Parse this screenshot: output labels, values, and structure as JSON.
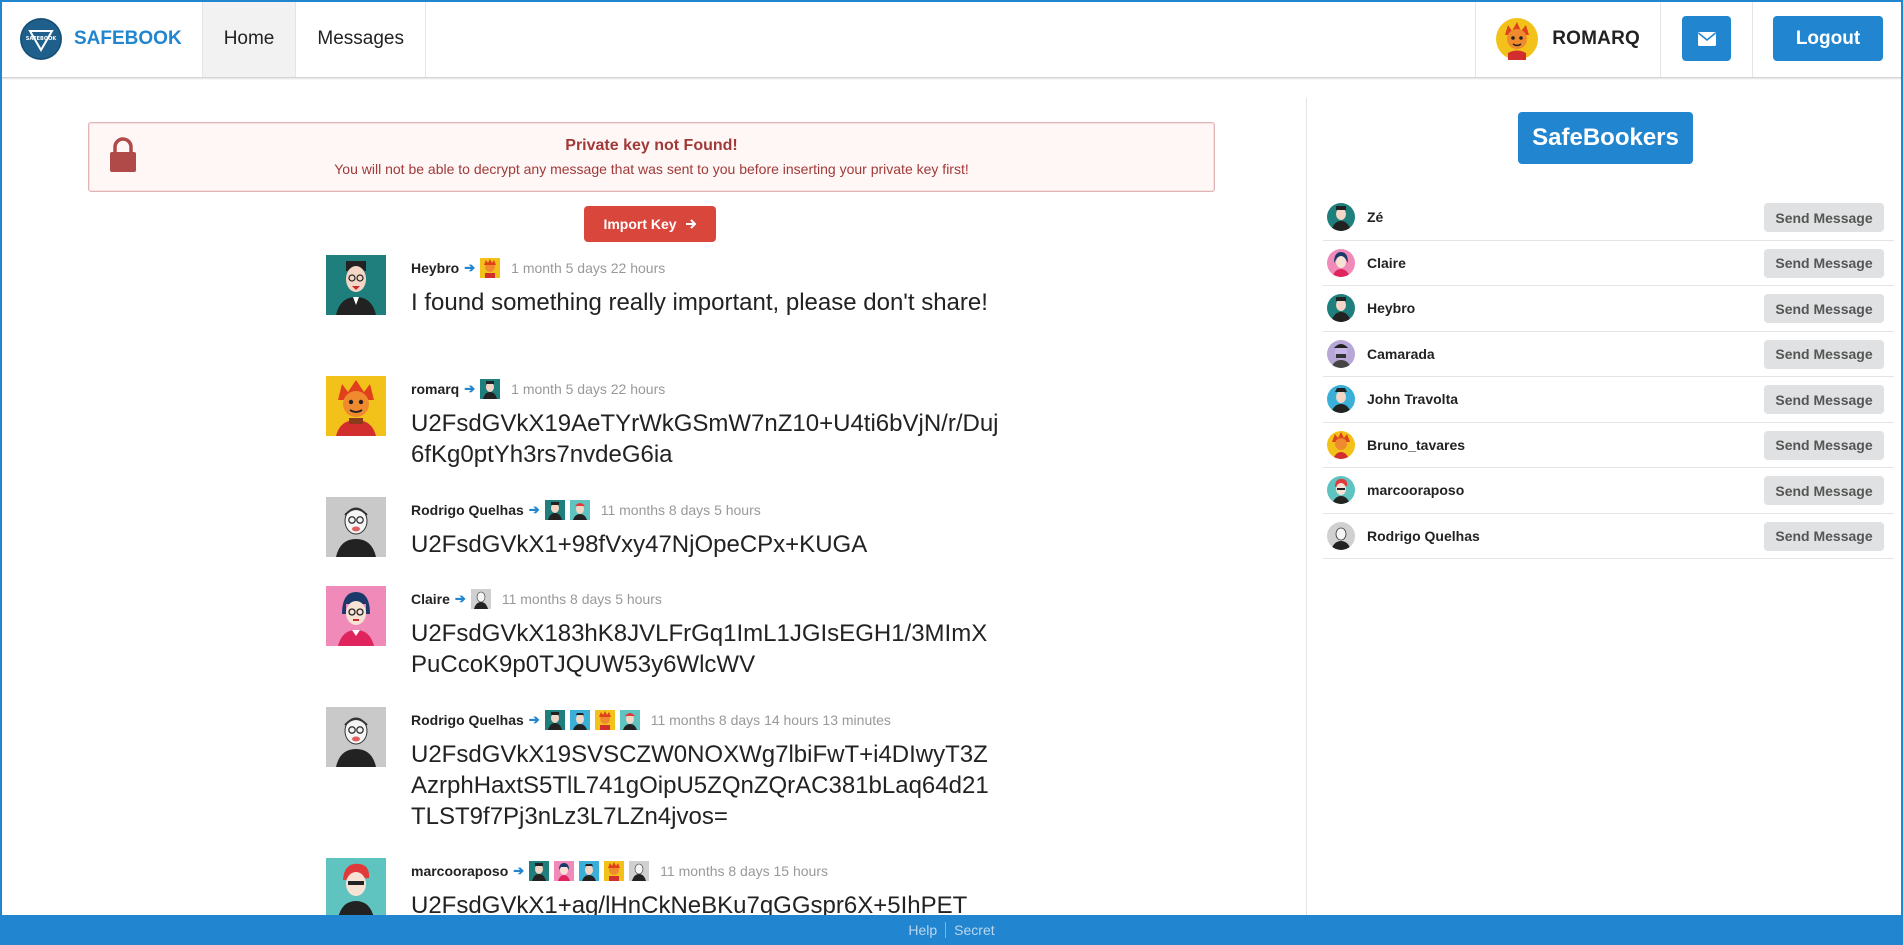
{
  "brand": {
    "name": "SAFEBOOK",
    "logo_text": "SAFEBOOK"
  },
  "nav": {
    "home": "Home",
    "messages": "Messages"
  },
  "user": {
    "name": "ROMARQ"
  },
  "header": {
    "mail_icon": "envelope-icon",
    "logout": "Logout"
  },
  "alert": {
    "title": "Private key not Found!",
    "text": "You will not be able to decrypt any message that was sent to you before inserting your private key first!",
    "icon": "lock-icon"
  },
  "import_button": "Import Key",
  "colors": {
    "primary": "#2185d0",
    "danger": "#d9463b",
    "alert_text": "#9f3a38",
    "alert_bg": "#fff6f6"
  },
  "feed": [
    {
      "author": "Heybro",
      "recipients": [
        "romarq"
      ],
      "time": "1 month 5 days 22 hours",
      "text": "I found something really important, please don't share!"
    },
    {
      "author": "romarq",
      "recipients": [
        "Heybro"
      ],
      "time": "1 month 5 days 22 hours",
      "text": "U2FsdGVkX19AeTYrWkGSmW7nZ10+U4ti6bVjN/r/Duj6fKg0ptYh3rs7nvdeG6ia"
    },
    {
      "author": "Rodrigo Quelhas",
      "recipients": [
        "Heybro",
        "marcooraposo"
      ],
      "time": "11 months 8 days 5 hours",
      "text": "U2FsdGVkX1+98fVxy47NjOpeCPx+KUGA"
    },
    {
      "author": "Claire",
      "recipients": [
        "Rodrigo Quelhas"
      ],
      "time": "11 months 8 days 5 hours",
      "text": "U2FsdGVkX183hK8JVLFrGq1ImL1JGIsEGH1/3MImXPuCcoK9p0TJQUW53y6WlcWV"
    },
    {
      "author": "Rodrigo Quelhas",
      "recipients": [
        "Heybro",
        "John Travolta",
        "Bruno_tavares",
        "marcooraposo"
      ],
      "time": "11 months 8 days 14 hours 13 minutes",
      "text": "U2FsdGVkX19SVSCZW0NOXWg7lbiFwT+i4DIwyT3ZAzrphHaxtS5TlL741gOipU5ZQnZQrAC381bLaq64d21TLST9f7Pj3nLz3L7LZn4jvos="
    },
    {
      "author": "marcooraposo",
      "recipients": [
        "Heybro",
        "Claire",
        "John Travolta",
        "Bruno_tavares",
        "Rodrigo Quelhas"
      ],
      "time": "11 months 8 days 15 hours",
      "text": "U2FsdGVkX1+ag/lHnCkNeBKu7qGGspr6X+5IhPET"
    }
  ],
  "sidebar": {
    "title": "SafeBookers",
    "send_label": "Send Message",
    "users": [
      "Zé",
      "Claire",
      "Heybro",
      "Camarada",
      "John Travolta",
      "Bruno_tavares",
      "marcooraposo",
      "Rodrigo Quelhas"
    ]
  },
  "footer": {
    "help": "Help",
    "secret": "Secret"
  }
}
